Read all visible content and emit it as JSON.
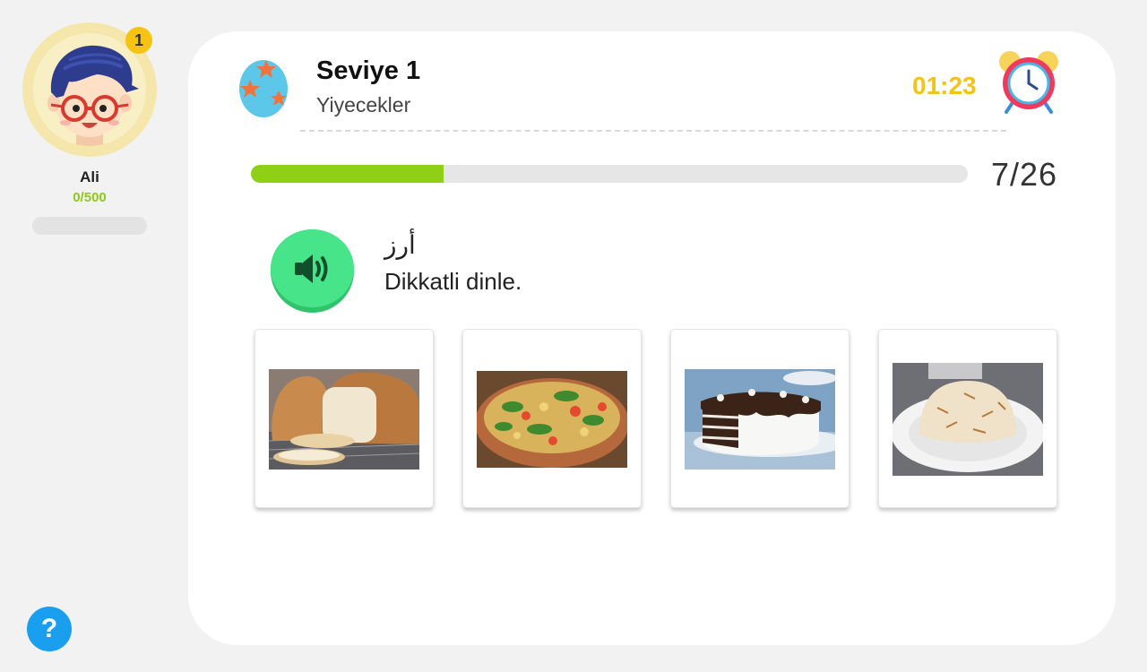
{
  "user": {
    "name": "Ali",
    "points": "0/500",
    "points_progress": 0,
    "level_badge": "1"
  },
  "help": {
    "label": "?"
  },
  "lesson": {
    "level_title": "Seviye 1",
    "category": "Yiyecekler",
    "timer": "01:23"
  },
  "progress": {
    "count_text": "7/26",
    "current": 7,
    "total": 26
  },
  "question": {
    "arabic_word": "أرز",
    "instruction": "Dikkatli dinle."
  },
  "answers": [
    {
      "image": "bread-image"
    },
    {
      "image": "pasta-salad-image"
    },
    {
      "image": "chocolate-cake-image"
    },
    {
      "image": "rice-pilaf-image"
    }
  ],
  "colors": {
    "accent_green": "#8fd016",
    "timer_yellow": "#f3c21b",
    "help_blue": "#1a9ef0",
    "sound_green": "#47e48a"
  }
}
